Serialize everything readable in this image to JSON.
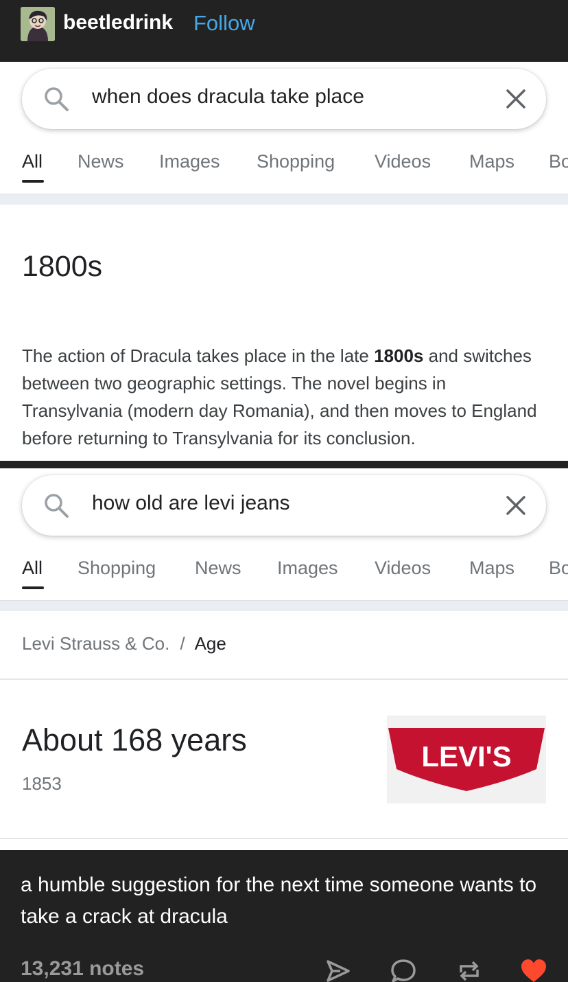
{
  "header": {
    "username": "beetledrink",
    "follow_label": "Follow",
    "follow_color": "#46a8e8",
    "avatar_icon": "avatar-icon"
  },
  "screenshots": [
    {
      "query": "when does dracula take place",
      "tabs": [
        "All",
        "News",
        "Images",
        "Shopping",
        "Videos",
        "Maps",
        "Bo"
      ],
      "active_tab": "All",
      "answer_title": "1800s",
      "snippet": {
        "before": "The action of Dracula takes place in the late ",
        "bold": "1800s",
        "after": " and switches between two geographic settings. The novel begins in Transylvania (modern day Romania), and then moves to England before returning to Transylvania for its conclusion."
      }
    },
    {
      "query": "how old are levi jeans",
      "tabs": [
        "All",
        "Shopping",
        "News",
        "Images",
        "Videos",
        "Maps",
        "Bo"
      ],
      "active_tab": "All",
      "breadcrumb": {
        "parent": "Levi Strauss & Co.",
        "separator": "/",
        "current": "Age"
      },
      "answer_title": "About 168 years",
      "answer_sub": "1853",
      "logo_text": "LEVI'S",
      "logo_color": "#c41230"
    }
  ],
  "caption": "a humble suggestion for the next time someone wants to take a crack at dracula",
  "footer": {
    "notes": "13,231 notes",
    "actions": [
      "share-icon",
      "reply-icon",
      "reblog-icon",
      "like-icon"
    ],
    "like_color": "#ff492f"
  }
}
